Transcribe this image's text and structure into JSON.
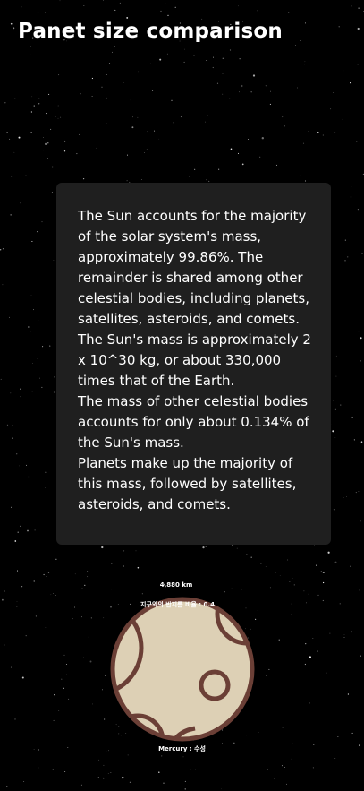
{
  "page": {
    "title": "Panet size comparison"
  },
  "info": {
    "paragraphs": [
      "The Sun accounts for the majority of the solar system's mass, approximately 99.86%. The remainder is shared among other celestial bodies, including planets, satellites, asteroids, and comets.",
      "The Sun's mass is approximately 2 x 10^30 kg, or about 330,000 times that of the Earth.",
      "The mass of other celestial bodies accounts for only about 0.134% of the Sun's mass.",
      "Planets make up the majority of this mass, followed by satellites, asteroids, and comets."
    ]
  },
  "planet": {
    "diameter_label": "4,880 km",
    "ratio_label": "지구와의 반지름 비율 : 0.4",
    "name_label": "Mercury : 수성",
    "icon": "mercury-planet-icon"
  },
  "colors": {
    "background": "#000000",
    "card": "#1f1f1f",
    "planet_fill": "#ddd0b5",
    "planet_stroke": "#6b3f36",
    "text": "#ffffff"
  }
}
